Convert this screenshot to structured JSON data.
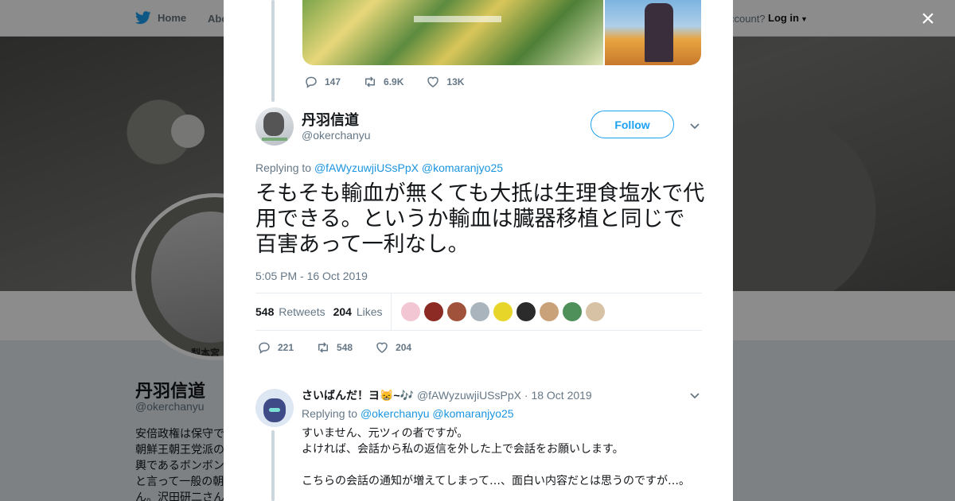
{
  "background": {
    "nav": {
      "home_label": "Home",
      "about_label": "Abo",
      "account_text": "ccount?",
      "login_label": "Log in"
    },
    "profile": {
      "name": "丹羽信道",
      "handle": "@okerchanyu",
      "avatar_caption": "梨本宮",
      "bio_lines": [
        "安倍政権は保守で",
        "朝鮮王朝王党派の",
        "輿であるボンボン",
        "と言って一般の朝",
        "ん。沢田研二さん"
      ]
    }
  },
  "modal": {
    "close_label": "×",
    "prev_tweet_actions": {
      "replies": "147",
      "retweets": "6.9K",
      "likes": "13K"
    },
    "tweet": {
      "author_name": "丹羽信道",
      "author_handle": "@okerchanyu",
      "follow_label": "Follow",
      "replying_prefix": "Replying to",
      "replying_to": [
        "@fAWyzuwjiUSsPpX",
        "@komaranjyo25"
      ],
      "text": "そもそも輸血が無くても大抵は生理食塩水で代用できる。というか輸血は臓器移植と同じで百害あって一利なし。",
      "timestamp": "5:05 PM - 16 Oct 2019",
      "retweets_count": "548",
      "retweets_label": "Retweets",
      "likes_count": "204",
      "likes_label": "Likes",
      "liker_avatar_colors": [
        "#f2c6d3",
        "#8b2b24",
        "#a0523a",
        "#aab4bd",
        "#e8d52a",
        "#2b2b2b",
        "#c9a27a",
        "#4f8f5a",
        "#d8c2a6"
      ],
      "actions": {
        "replies": "221",
        "retweets": "548",
        "likes": "204"
      }
    },
    "reply": {
      "author_name": "さいばんだ！ヨ😸~🎶",
      "author_handle": "@fAWyzuwjiUSsPpX",
      "date": "18 Oct 2019",
      "separator": "·",
      "replying_prefix": "Replying to",
      "replying_to": [
        "@okerchanyu",
        "@komaranjyo25"
      ],
      "text_lines": [
        "すいません、元ツィの者ですが。",
        "よければ、会話から私の返信を外した上で会話をお願いします。",
        "",
        "こちらの会話の通知が増えてしまって…、面白い内容だとは思うのですが…。"
      ]
    }
  },
  "colors": {
    "accent": "#1da1f2",
    "link": "#1b95e0",
    "muted": "#657786",
    "border": "#e6ecf0"
  }
}
